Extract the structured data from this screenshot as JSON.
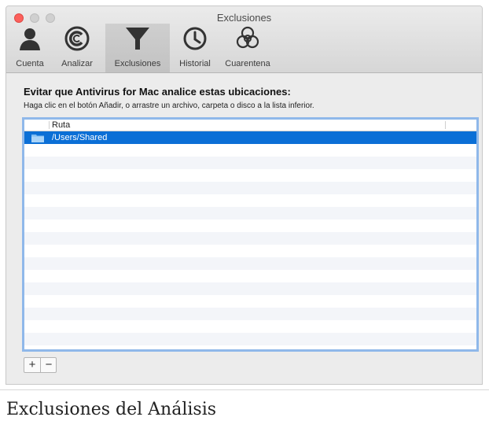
{
  "window": {
    "title": "Exclusiones"
  },
  "toolbar": {
    "tabs": [
      {
        "label": "Cuenta",
        "icon": "person-icon"
      },
      {
        "label": "Analizar",
        "icon": "scan-icon"
      },
      {
        "label": "Exclusiones",
        "icon": "funnel-icon",
        "active": true
      },
      {
        "label": "Historial",
        "icon": "clock-icon"
      },
      {
        "label": "Cuarentena",
        "icon": "biohazard-icon"
      }
    ]
  },
  "main": {
    "heading": "Evitar que Antivirus for Mac analice estas ubicaciones:",
    "instructions": "Haga clic en el botón Añadir, o arrastre un archivo, carpeta o disco a la lista inferior.",
    "list": {
      "column_header": "Ruta",
      "items": [
        {
          "path": "/Users/Shared",
          "selected": true,
          "icon": "folder-icon"
        }
      ]
    },
    "buttons": {
      "add": "+",
      "remove": "−"
    }
  },
  "caption": "Exclusiones del Análisis",
  "colors": {
    "selection": "#0b6fd6",
    "focus_ring": "#8fb8ea",
    "close_button": "#fc605c"
  }
}
